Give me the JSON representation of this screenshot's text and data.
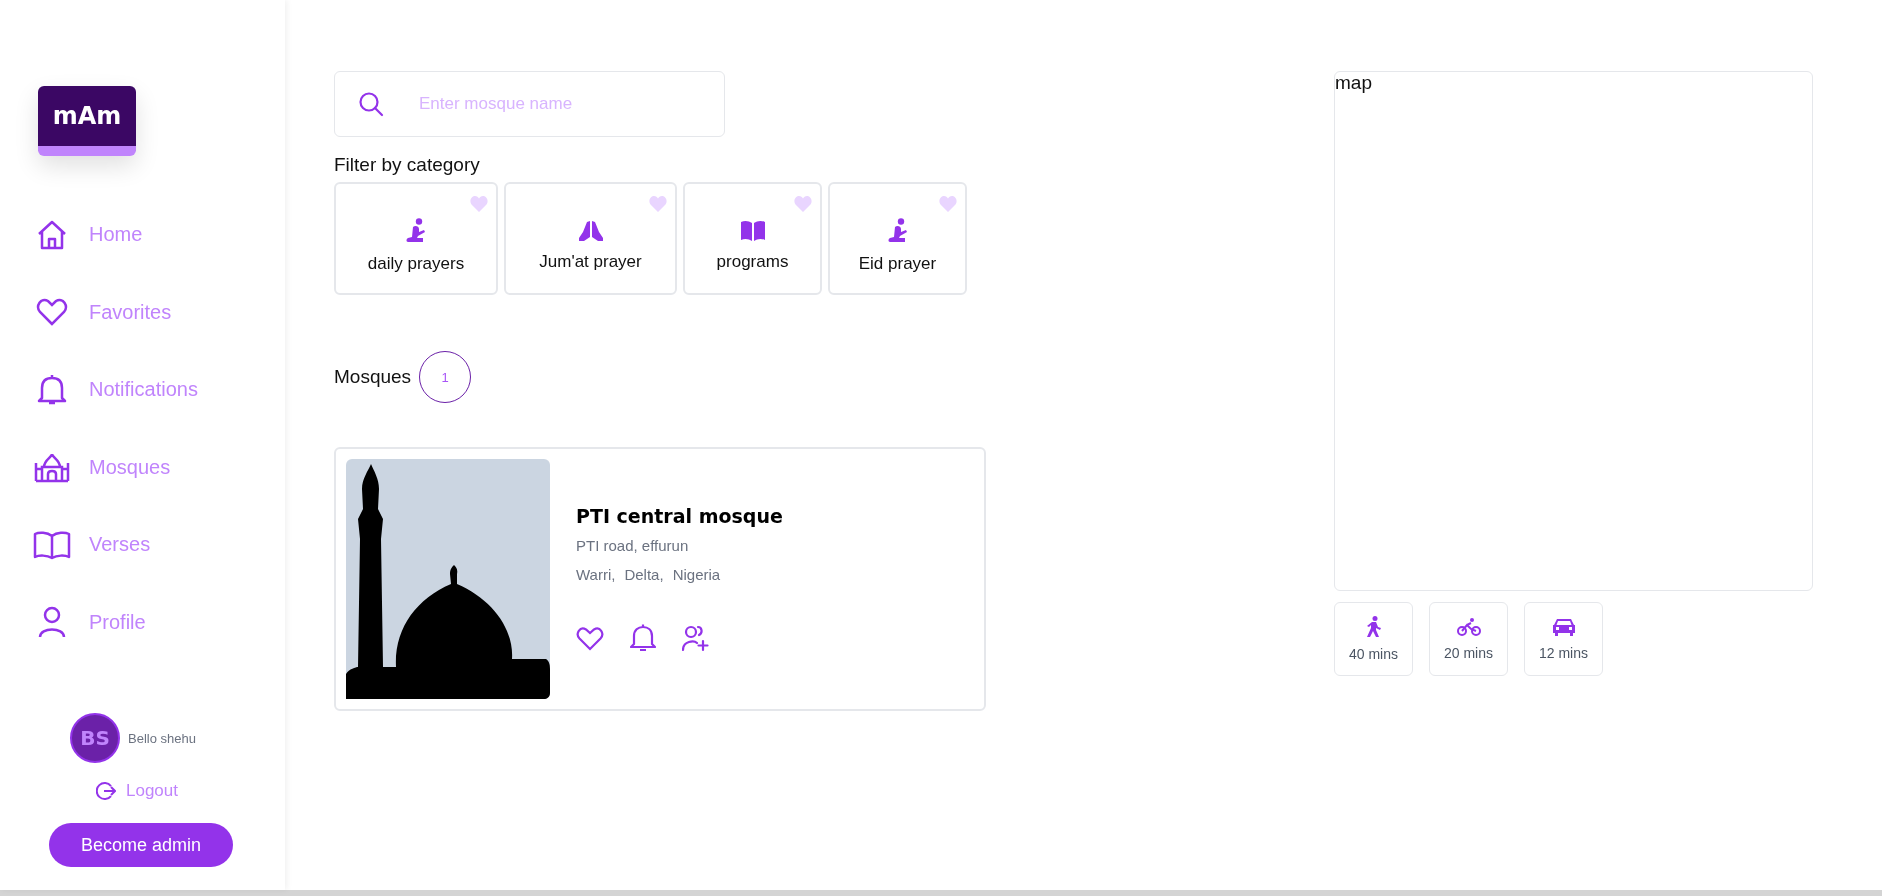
{
  "logo": {
    "text": "mAm"
  },
  "nav": [
    {
      "label": "Home",
      "kind": "home"
    },
    {
      "label": "Favorites",
      "kind": "heart"
    },
    {
      "label": "Notifications",
      "kind": "bell"
    },
    {
      "label": "Mosques",
      "kind": "mosque"
    },
    {
      "label": "Verses",
      "kind": "book"
    },
    {
      "label": "Profile",
      "kind": "user"
    }
  ],
  "user": {
    "initials": "BS",
    "name": "Bello shehu"
  },
  "logout": "Logout",
  "admin_button": "Become admin",
  "search": {
    "placeholder": "Enter mosque name"
  },
  "filter": {
    "title": "Filter by category",
    "categories": [
      {
        "label": "daily prayers",
        "kind": "kneel"
      },
      {
        "label": "Jum'at prayer",
        "kind": "hands"
      },
      {
        "label": "programs",
        "kind": "book"
      },
      {
        "label": "Eid prayer",
        "kind": "kneel"
      }
    ]
  },
  "mosques": {
    "title": "Mosques",
    "count": "1",
    "items": [
      {
        "name": "PTI central mosque",
        "address": "PTI road, effurun",
        "city": "Warri,",
        "state": "Delta,",
        "country": "Nigeria"
      }
    ]
  },
  "map": {
    "label": "map"
  },
  "travel": [
    {
      "kind": "walk",
      "time": "40 mins"
    },
    {
      "kind": "bike",
      "time": "20 mins"
    },
    {
      "kind": "car",
      "time": "12 mins"
    }
  ]
}
